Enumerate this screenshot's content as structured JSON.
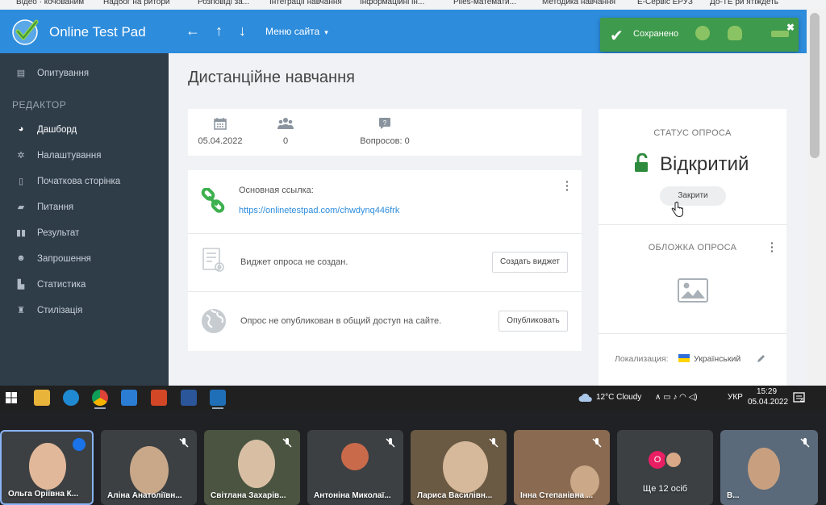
{
  "bookmarks": [
    "Відео · кочованим",
    "Надбог на ритори",
    "Розповіді за...",
    "Інтеграції навчання",
    "Інформаційні ін...",
    "Piles-математи...",
    "Методика навчання",
    "E-Сервіс ЕРУЗ",
    "До-ТЕ ри ятіждеть"
  ],
  "header": {
    "app_title": "Online Test Pad",
    "back_icon": "←",
    "up_icon": "↑",
    "down_icon": "↓",
    "site_menu_label": "Меню сайта",
    "site_menu_caret": "▾"
  },
  "toast": {
    "text": "Сохранено",
    "check_icon": "✔",
    "close_icon": "✖"
  },
  "sidebar": {
    "section_label": "РЕДАКТОР",
    "items": [
      {
        "label": "Опитування",
        "icon": "survey-icon"
      },
      {
        "label": "Дашборд",
        "icon": "dashboard-icon",
        "active": true
      },
      {
        "label": "Налаштування",
        "icon": "gear-icon"
      },
      {
        "label": "Початкова сторінка",
        "icon": "page-icon"
      },
      {
        "label": "Питання",
        "icon": "questions-icon"
      },
      {
        "label": "Результат",
        "icon": "results-icon"
      },
      {
        "label": "Запрошення",
        "icon": "invite-icon"
      },
      {
        "label": "Статистика",
        "icon": "statistics-icon"
      },
      {
        "label": "Стилізація",
        "icon": "style-icon"
      }
    ]
  },
  "main": {
    "page_title": "Дистанційне навчання",
    "stats": {
      "date": "05.04.2022",
      "participants": "0",
      "questions": "Вопросов: 0"
    },
    "links": {
      "main_link_label": "Основная ссылка:",
      "main_link_url": "https://onlinetestpad.com/chwdynq446frk",
      "widget_text": "Виджет опроса не создан.",
      "widget_button": "Создать виджет",
      "publish_text": "Опрос не опубликован в общий доступ на сайте.",
      "publish_button": "Опубликовать"
    },
    "status": {
      "heading": "СТАТУС ОПРОСА",
      "value": "Відкритий",
      "close_button": "Закрити",
      "cover_heading": "ОБЛОЖКА ОПРОСА",
      "locale_label": "Локализация:",
      "locale_value": "Український"
    }
  },
  "taskbar": {
    "weather": "12°C  Cloudy",
    "lang": "УКР",
    "time": "15:29",
    "date": "05.04.2022",
    "notifications": "4",
    "tray_icons": "∧  ▭  ♪  ◠  ◁)"
  },
  "meeting": {
    "participants": [
      {
        "name": "Ольга Оріївна К...",
        "color": "#b89a7e"
      },
      {
        "name": "Аліна Анатоліївн...",
        "color": "#8a9aa8"
      },
      {
        "name": "Світлана Захарів...",
        "color": "#6e7a5a"
      },
      {
        "name": "Антоніна Миколаї...",
        "color": "#3c4043"
      },
      {
        "name": "Лариса Василівн...",
        "color": "#7a6a52"
      },
      {
        "name": "Інна Степанівна ...",
        "color": "#a07a5a"
      },
      {
        "name": "Ще 12 осіб",
        "color": "#3c4043"
      },
      {
        "name": "В...",
        "color": "#6a7a8a"
      }
    ],
    "more_initial": "O"
  },
  "colors": {
    "header": "#2d8cdc",
    "sidebar": "#2f3d49",
    "toast": "#3e9a4c",
    "lock": "#2e8b3e",
    "link": "#2d8cdc"
  }
}
